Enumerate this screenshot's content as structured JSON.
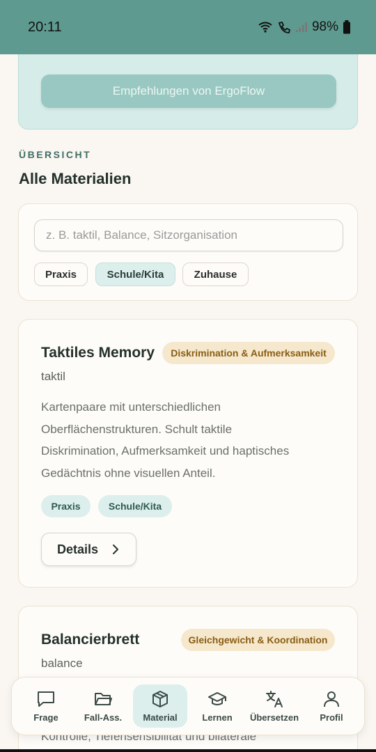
{
  "status": {
    "time": "20:11",
    "battery": "98%"
  },
  "recommend": {
    "button_label": "Empfehlungen von ErgoFlow"
  },
  "section": {
    "eyebrow": "ÜBERSICHT",
    "title": "Alle Materialien"
  },
  "filter": {
    "search_placeholder": "z. B. taktil, Balance, Sitzorganisation",
    "chips": [
      {
        "label": "Praxis",
        "active": false
      },
      {
        "label": "Schule/Kita",
        "active": true
      },
      {
        "label": "Zuhause",
        "active": false
      }
    ]
  },
  "materials": [
    {
      "title": "Taktiles Memory",
      "badge": "Diskrimination & Aufmerksamkeit",
      "subtitle": "taktil",
      "description_lines": [
        "Kartenpaare mit unterschiedlichen",
        "Oberflächenstrukturen. Schult taktile",
        "Diskrimination, Aufmerksamkeit und haptisches",
        "Gedächtnis ohne visuellen Anteil."
      ],
      "tags": [
        "Praxis",
        "Schule/Kita"
      ],
      "details_label": "Details"
    },
    {
      "title": "Balancierbrett",
      "badge": "Gleichgewicht & Koordination",
      "subtitle": "balance",
      "description_partial": "Kontrolle, Tiefensensibilität und bilaterale"
    }
  ],
  "nav": [
    {
      "label": "Frage",
      "icon": "chat-icon",
      "active": false
    },
    {
      "label": "Fall-Ass.",
      "icon": "folder-icon",
      "active": false
    },
    {
      "label": "Material",
      "icon": "box-icon",
      "active": true
    },
    {
      "label": "Lernen",
      "icon": "graduation-cap-icon",
      "active": false
    },
    {
      "label": "Übersetzen",
      "icon": "translate-icon",
      "active": false
    },
    {
      "label": "Profil",
      "icon": "person-icon",
      "active": false
    }
  ],
  "colors": {
    "status_bar": "#5e9a8f",
    "accent_light": "#dcefec",
    "badge_bg": "#f5e8cd",
    "badge_text": "#8a5d14",
    "background": "#faf6f1"
  }
}
